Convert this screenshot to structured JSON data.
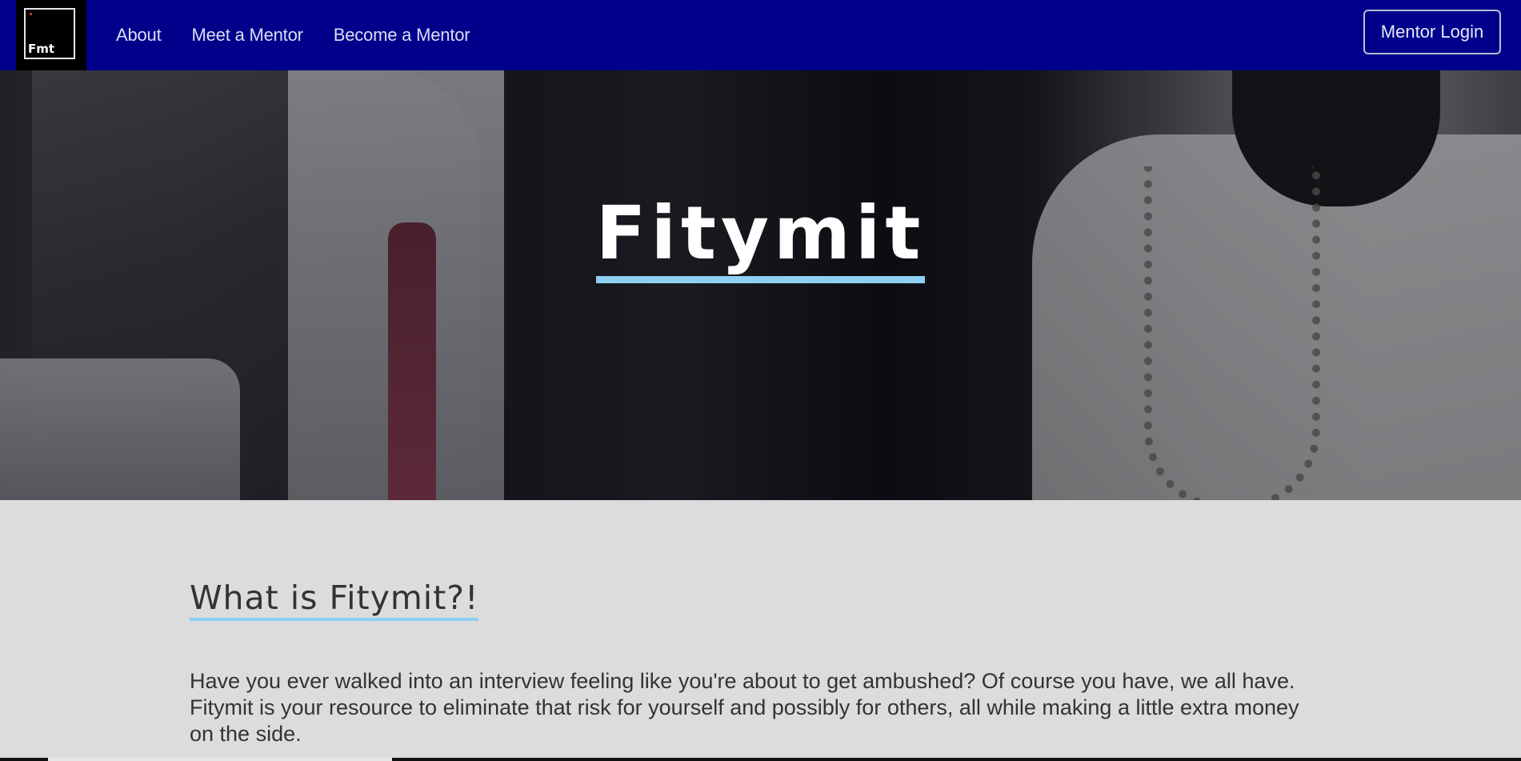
{
  "nav": {
    "logo_text": "Fmt",
    "links": [
      {
        "label": "About"
      },
      {
        "label": "Meet a Mentor"
      },
      {
        "label": "Become a Mentor"
      }
    ],
    "login_label": "Mentor Login"
  },
  "hero": {
    "title": "Fitymit"
  },
  "main": {
    "heading": "What is Fitymit?!",
    "intro": "Have you ever walked into an interview feeling like you're about to get ambushed? Of course you have, we all have. Fitymit is your resource to eliminate that risk for yourself and possibly for others, all while making a little extra money on the side."
  },
  "colors": {
    "nav_bg": "#00008b",
    "accent_underline": "#8fcff3",
    "content_bg": "#dcdcdc"
  }
}
